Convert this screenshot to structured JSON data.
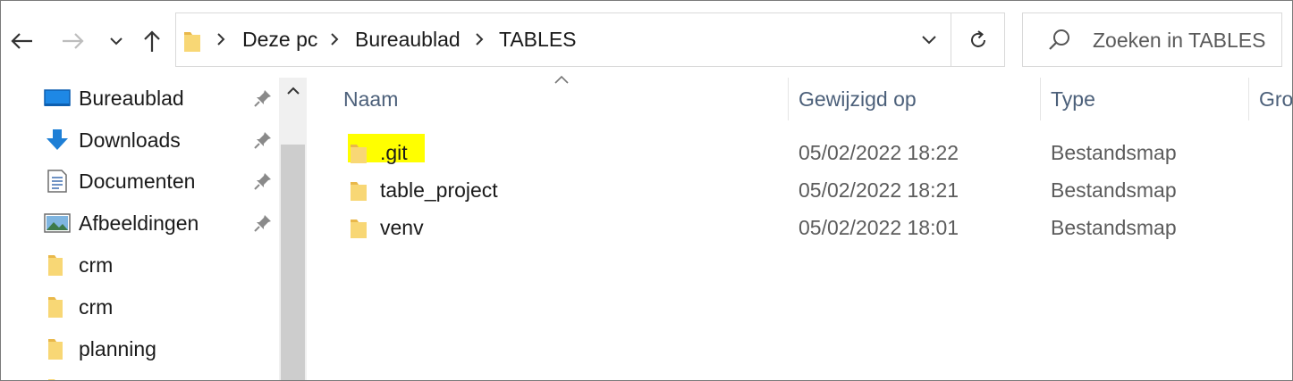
{
  "toolbar": {
    "back_icon": "arrow-left-icon",
    "forward_icon": "arrow-right-icon",
    "recent_icon": "chevron-down-icon",
    "up_icon": "arrow-up-icon"
  },
  "address_bar": {
    "breadcrumbs": [
      "Deze pc",
      "Bureaublad",
      "TABLES"
    ],
    "dropdown_icon": "chevron-down-icon",
    "refresh_icon": "refresh-icon"
  },
  "search": {
    "placeholder": "Zoeken in TABLES",
    "value": ""
  },
  "sidebar": {
    "items": [
      {
        "label": "Bureaublad",
        "icon": "desktop-icon",
        "pinned": true
      },
      {
        "label": "Downloads",
        "icon": "download-icon",
        "pinned": true
      },
      {
        "label": "Documenten",
        "icon": "document-icon",
        "pinned": true
      },
      {
        "label": "Afbeeldingen",
        "icon": "image-icon",
        "pinned": true
      },
      {
        "label": "crm",
        "icon": "folder-icon",
        "pinned": false
      },
      {
        "label": "crm",
        "icon": "folder-icon",
        "pinned": false
      },
      {
        "label": "planning",
        "icon": "folder-icon",
        "pinned": false
      }
    ]
  },
  "file_list": {
    "columns": [
      "Naam",
      "Gewijzigd op",
      "Type",
      "Gro"
    ],
    "sort_column": "Naam",
    "rows": [
      {
        "name": ".git",
        "modified": "05/02/2022 18:22",
        "type": "Bestandsmap",
        "highlighted": true
      },
      {
        "name": "table_project",
        "modified": "05/02/2022 18:21",
        "type": "Bestandsmap",
        "highlighted": false
      },
      {
        "name": "venv",
        "modified": "05/02/2022 18:01",
        "type": "Bestandsmap",
        "highlighted": false
      }
    ]
  },
  "colors": {
    "folder": "#f8d775",
    "folder_dark": "#e9b84a",
    "header_text": "#4c607a",
    "highlight": "#ffff00",
    "scrollbar_track": "#f0f0f0",
    "scrollbar_thumb": "#cdcdcd"
  }
}
